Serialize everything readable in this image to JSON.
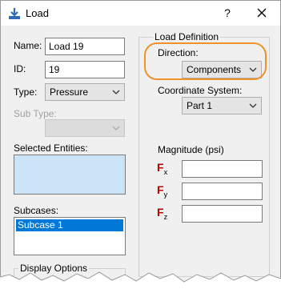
{
  "window": {
    "title": "Load",
    "help_label": "?"
  },
  "left": {
    "name_label": "Name:",
    "name_value": "Load 19",
    "id_label": "ID:",
    "id_value": "19",
    "type_label": "Type:",
    "type_value": "Pressure",
    "subtype_label": "Sub Type:",
    "selected_label": "Selected Entities:",
    "subcases_label": "Subcases:",
    "subcases": [
      "Subcase 1"
    ],
    "display_options_label": "Display Options"
  },
  "right": {
    "group_title": "Load Definition",
    "direction_label": "Direction:",
    "direction_value": "Components",
    "coord_label": "Coordinate System:",
    "coord_value": "Part 1",
    "magnitude_label": "Magnitude (psi)",
    "components": [
      {
        "symbol": "F",
        "sub": "x"
      },
      {
        "symbol": "F",
        "sub": "y"
      },
      {
        "symbol": "F",
        "sub": "z"
      }
    ]
  },
  "colors": {
    "highlight": "#f0922a",
    "selection": "#0078d7",
    "force_symbol": "#c00000"
  }
}
